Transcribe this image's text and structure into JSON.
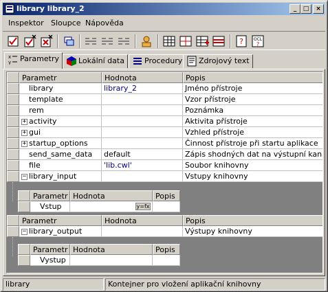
{
  "window": {
    "title": "library library_2",
    "minimize": "_",
    "maximize": "□",
    "close": "×"
  },
  "menu": {
    "items": [
      "Inspektor",
      "Sloupce",
      "Nápověda"
    ]
  },
  "tabs": [
    "Parametry",
    "Lokální data",
    "Procedury",
    "Zdrojový text"
  ],
  "grid": {
    "headers": [
      "Parametr",
      "Hodnota",
      "Popis"
    ],
    "rows": [
      {
        "param": "library",
        "value": "library_2",
        "desc": "Jméno přístroje"
      },
      {
        "param": "template",
        "value": "",
        "desc": "Vzor přístroje"
      },
      {
        "param": "rem",
        "value": "",
        "desc": "Poznámka"
      },
      {
        "param": "activity",
        "value": "",
        "desc": "Aktivita přístroje",
        "expand": "+"
      },
      {
        "param": "gui",
        "value": "",
        "desc": "Vzhled přístroje",
        "expand": "+"
      },
      {
        "param": "startup_options",
        "value": "",
        "desc": "Činnost přístroje při startu aplikace",
        "expand": "+"
      },
      {
        "param": "send_same_data",
        "value": "default",
        "desc": "Zápis shodných dat na výstupní kanály"
      },
      {
        "param": "file",
        "value": "'lib.cwl'",
        "desc": "Soubor knihovny"
      },
      {
        "param": "library_input",
        "value": "",
        "desc": "Vstupy knihovny",
        "expand": "−"
      }
    ],
    "sub_input": {
      "headers": [
        "Parametr",
        "Hodnota",
        "Popis"
      ],
      "row": {
        "param": "Vstup",
        "value": "",
        "desc": "",
        "button": "y=fx"
      }
    },
    "second_header": [
      "Parametr",
      "Hodnota",
      "Popis"
    ],
    "output_row": {
      "param": "library_output",
      "value": "",
      "desc": "Výstupy knihovny",
      "expand": "−"
    },
    "sub_output": {
      "headers": [
        "Parametr",
        "Hodnota",
        "Popis"
      ],
      "row": {
        "param": "Vystup",
        "value": "",
        "desc": ""
      }
    }
  },
  "status": {
    "left": "library",
    "right": "Kontejner pro vložení aplikační knihovny"
  },
  "colors": {
    "title_start": "#0a246a",
    "title_end": "#a6caf0",
    "value_text": "#000080"
  }
}
